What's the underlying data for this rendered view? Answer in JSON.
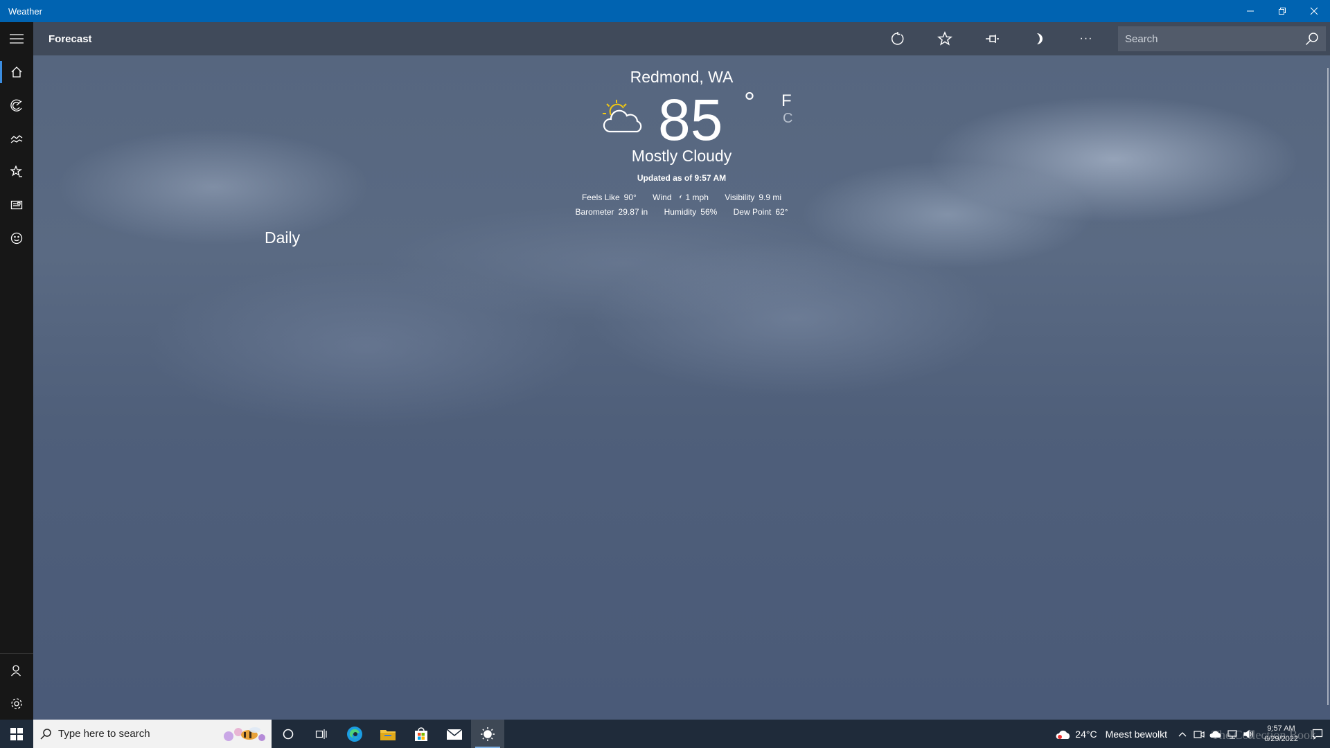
{
  "window": {
    "title": "Weather"
  },
  "appbar": {
    "title": "Forecast",
    "search_placeholder": "Search",
    "more_label": "···"
  },
  "current": {
    "location": "Redmond, WA",
    "temperature": "85",
    "degree_symbol": "°",
    "unit_f": "F",
    "unit_c": "C",
    "condition": "Mostly Cloudy",
    "updated": "Updated as of 9:57 AM",
    "feels_like_label": "Feels Like",
    "feels_like": "90°",
    "wind_label": "Wind",
    "wind": "1 mph",
    "visibility_label": "Visibility",
    "visibility": "9.9 mi",
    "barometer_label": "Barometer",
    "barometer": "29.87 in",
    "humidity_label": "Humidity",
    "humidity": "56%",
    "dew_point_label": "Dew Point",
    "dew_point": "62°"
  },
  "section": {
    "daily": "Daily"
  },
  "taskbar": {
    "search_placeholder": "Type here to search",
    "weather_temp": "24°C",
    "weather_text": "Meest bewolkt",
    "time": "9:57 AM",
    "date": "6/29/2022",
    "watermark": "The Collection Book"
  }
}
